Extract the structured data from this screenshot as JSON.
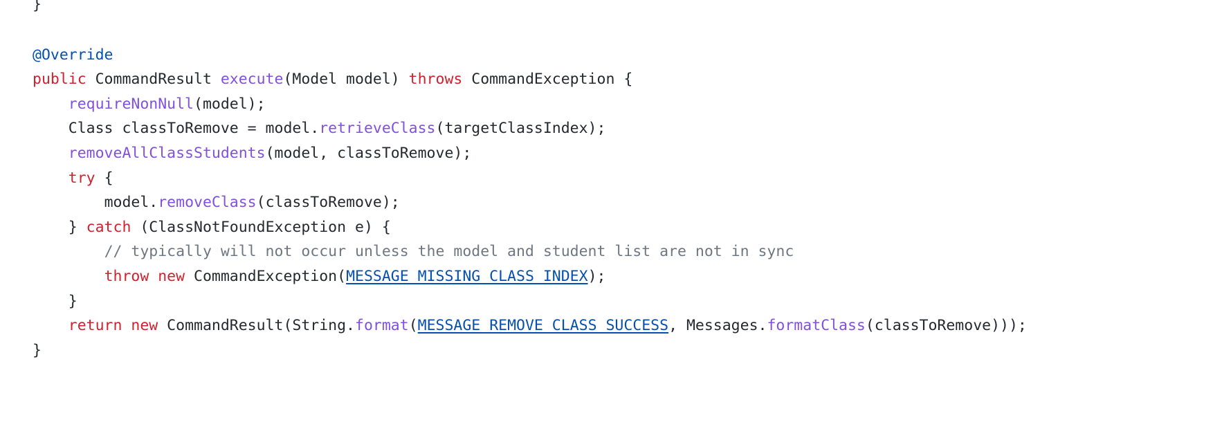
{
  "editor": {
    "language": "java",
    "background": "#ffffff",
    "colors": {
      "keyword": "#cf222e",
      "function": "#8250df",
      "annotation": "#0550ae",
      "constant": "#0550ae",
      "comment": "#6e7781",
      "plain": "#24292f"
    }
  },
  "code": {
    "lines": [
      {
        "indent": 0,
        "tokens": [
          {
            "type": "plain",
            "text": "}"
          }
        ]
      },
      {
        "indent": 0,
        "tokens": []
      },
      {
        "indent": 0,
        "tokens": [
          {
            "type": "annotation",
            "text": "@Override"
          }
        ]
      },
      {
        "indent": 0,
        "tokens": [
          {
            "type": "keyword",
            "text": "public"
          },
          {
            "type": "plain",
            "text": " CommandResult "
          },
          {
            "type": "function",
            "text": "execute"
          },
          {
            "type": "plain",
            "text": "(Model model) "
          },
          {
            "type": "keyword",
            "text": "throws"
          },
          {
            "type": "plain",
            "text": " CommandException {"
          }
        ]
      },
      {
        "indent": 1,
        "tokens": [
          {
            "type": "function",
            "text": "requireNonNull"
          },
          {
            "type": "plain",
            "text": "(model);"
          }
        ]
      },
      {
        "indent": 1,
        "tokens": [
          {
            "type": "plain",
            "text": "Class classToRemove = model."
          },
          {
            "type": "function",
            "text": "retrieveClass"
          },
          {
            "type": "plain",
            "text": "(targetClassIndex);"
          }
        ]
      },
      {
        "indent": 1,
        "tokens": [
          {
            "type": "function",
            "text": "removeAllClassStudents"
          },
          {
            "type": "plain",
            "text": "(model, classToRemove);"
          }
        ]
      },
      {
        "indent": 1,
        "tokens": [
          {
            "type": "keyword",
            "text": "try"
          },
          {
            "type": "plain",
            "text": " {"
          }
        ]
      },
      {
        "indent": 2,
        "tokens": [
          {
            "type": "plain",
            "text": "model."
          },
          {
            "type": "function",
            "text": "removeClass"
          },
          {
            "type": "plain",
            "text": "(classToRemove);"
          }
        ]
      },
      {
        "indent": 1,
        "tokens": [
          {
            "type": "plain",
            "text": "} "
          },
          {
            "type": "keyword",
            "text": "catch"
          },
          {
            "type": "plain",
            "text": " (ClassNotFoundException e) {"
          }
        ]
      },
      {
        "indent": 2,
        "tokens": [
          {
            "type": "comment",
            "text": "// typically will not occur unless the model and student list are not in sync"
          }
        ]
      },
      {
        "indent": 2,
        "tokens": [
          {
            "type": "keyword",
            "text": "throw new"
          },
          {
            "type": "plain",
            "text": " CommandException("
          },
          {
            "type": "constant",
            "text": "MESSAGE_MISSING_CLASS_INDEX"
          },
          {
            "type": "plain",
            "text": ");"
          }
        ]
      },
      {
        "indent": 1,
        "tokens": [
          {
            "type": "plain",
            "text": "}"
          }
        ]
      },
      {
        "indent": 1,
        "tokens": [
          {
            "type": "keyword",
            "text": "return new"
          },
          {
            "type": "plain",
            "text": " CommandResult(String."
          },
          {
            "type": "function",
            "text": "format"
          },
          {
            "type": "plain",
            "text": "("
          },
          {
            "type": "constant",
            "text": "MESSAGE_REMOVE_CLASS_SUCCESS"
          },
          {
            "type": "plain",
            "text": ", Messages."
          },
          {
            "type": "function",
            "text": "formatClass"
          },
          {
            "type": "plain",
            "text": "(classToRemove)));"
          }
        ]
      },
      {
        "indent": 0,
        "tokens": [
          {
            "type": "plain",
            "text": "}"
          }
        ]
      }
    ]
  }
}
